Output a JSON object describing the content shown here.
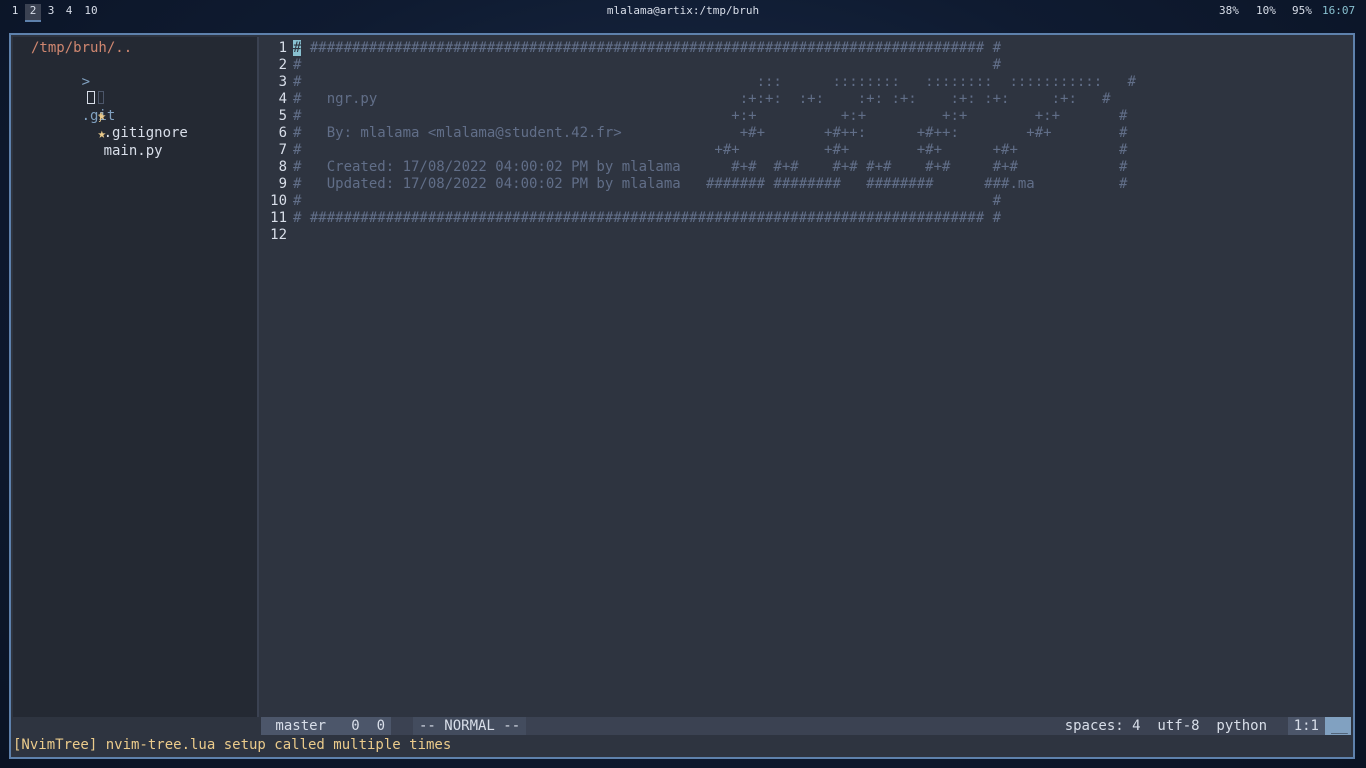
{
  "topbar": {
    "workspaces": [
      "1",
      "2",
      "3",
      "4",
      "10"
    ],
    "active_workspace": "2",
    "window_title": "mlalama@artix:/tmp/bruh",
    "cpu": "38%",
    "mem": "10%",
    "battery": "95%",
    "time": "16:07"
  },
  "tree": {
    "root": "/tmp/bruh/..",
    "items": [
      {
        "arrow": ">",
        "icon": "",
        "name": ".git"
      },
      {
        "arrow": "",
        "icon": "★",
        "name": ".gitignore"
      },
      {
        "arrow": "",
        "icon": "★",
        "name": "main.py"
      }
    ]
  },
  "editor": {
    "lines": [
      {
        "n": "1",
        "text": "# ################################################################################ #"
      },
      {
        "n": "2",
        "text": "#                                                                                  #"
      },
      {
        "n": "3",
        "text": "#                                                      :::      ::::::::   ::::::::  :::::::::::   #"
      },
      {
        "n": "4",
        "text": "#   ngr.py                                           :+:+:  :+:    :+: :+:    :+: :+:     :+:   #"
      },
      {
        "n": "5",
        "text": "#                                                   +:+          +:+         +:+        +:+       #"
      },
      {
        "n": "6",
        "text": "#   By: mlalama <mlalama@student.42.fr>              +#+       +#++:      +#++:        +#+        #"
      },
      {
        "n": "7",
        "text": "#                                                 +#+          +#+        +#+      +#+            #"
      },
      {
        "n": "8",
        "text": "#   Created: 17/08/2022 04:00:02 PM by mlalama      #+#  #+#    #+# #+#    #+#     #+#            #"
      },
      {
        "n": "9",
        "text": "#   Updated: 17/08/2022 04:00:02 PM by mlalama   ####### ########   ########      ###.ma          #"
      },
      {
        "n": "10",
        "text": "#                                                                                  #"
      },
      {
        "n": "11",
        "text": "# ################################################################################ #"
      },
      {
        "n": "12",
        "text": ""
      }
    ]
  },
  "statusline": {
    "git": " master   0  0",
    "mode": "-- NORMAL --",
    "right": "spaces: 4  utf-8  python",
    "position": "1:1",
    "end": "__"
  },
  "cmdline": "[NvimTree] nvim-tree.lua setup called multiple times"
}
